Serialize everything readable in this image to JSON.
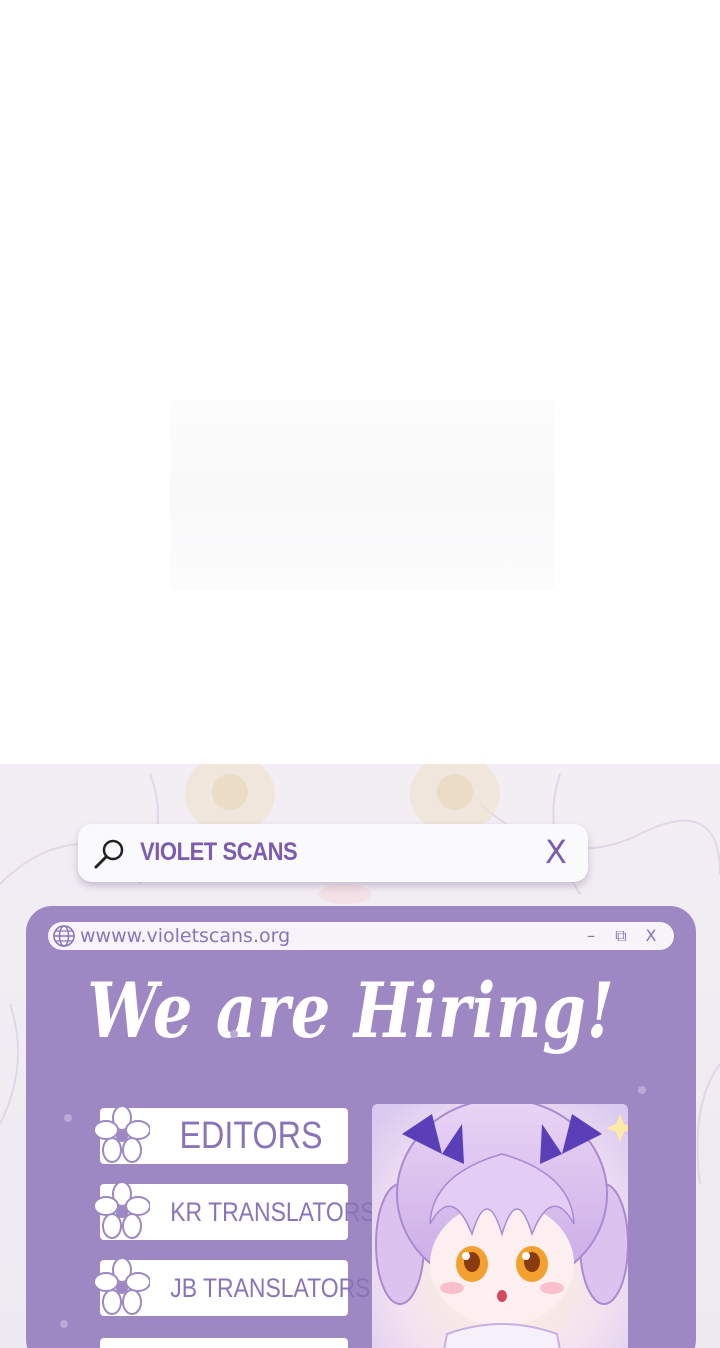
{
  "search": {
    "query": "VIOLET SCANS",
    "icon": "search-icon",
    "close_icon": "close-icon",
    "close_glyph": "X"
  },
  "window": {
    "url": "wwww.violetscans.org",
    "controls": [
      "–",
      "⧉",
      "X"
    ]
  },
  "heading": "We are Hiring!",
  "roles": [
    {
      "label": "EDITORS"
    },
    {
      "label": "KR TRANSLATORS"
    },
    {
      "label": "JB TRANSLATORS"
    }
  ],
  "colors": {
    "accent": "#7c5bb0",
    "panel": "#9d88c3",
    "background": "#f3eef4"
  }
}
